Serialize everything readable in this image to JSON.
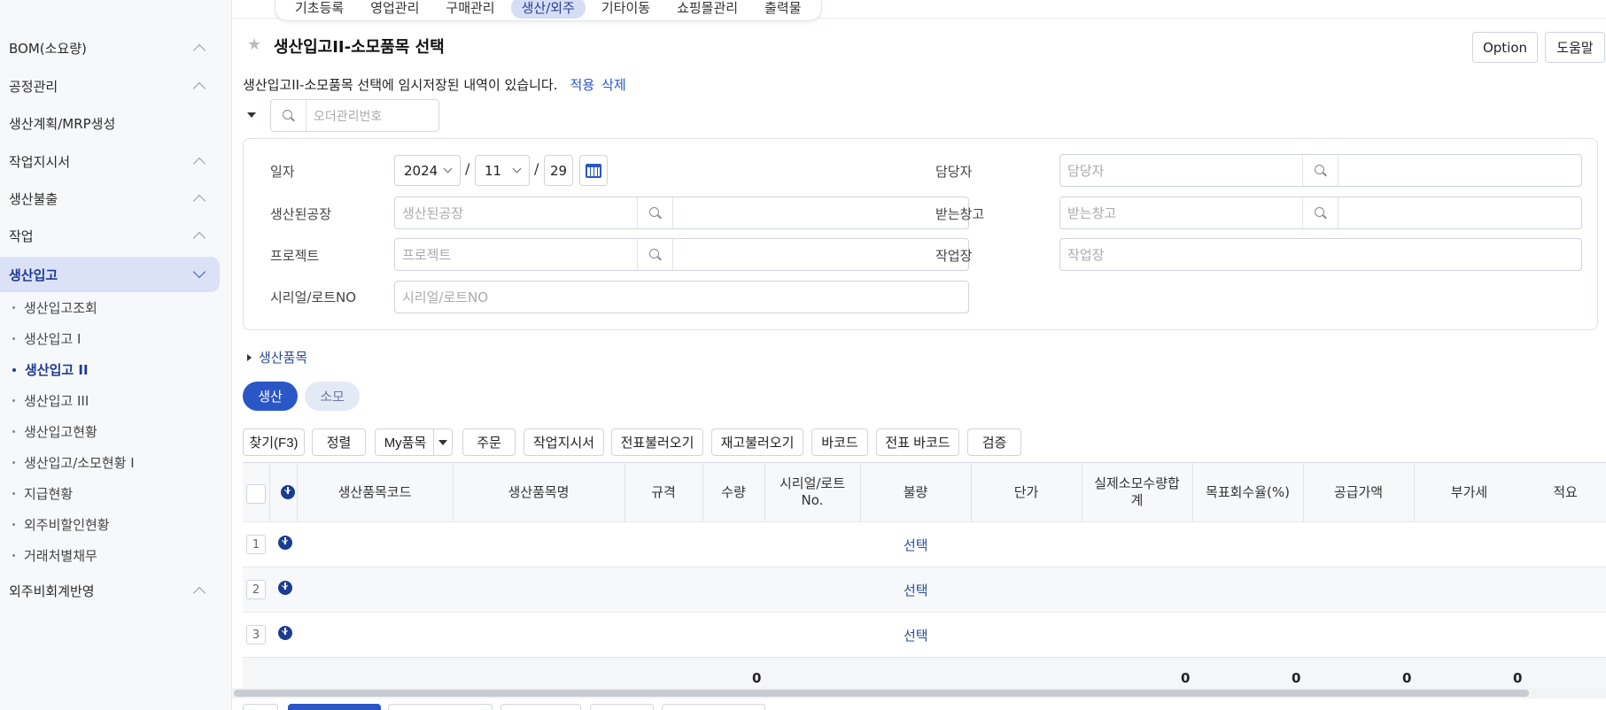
{
  "top_menu": [
    "기초등록",
    "영업관리",
    "구매관리",
    "생산/외주",
    "기타이동",
    "쇼핑몰관리",
    "출력물"
  ],
  "sidebar": {
    "groups": {
      "bom": "BOM(소요량)",
      "process": "공정관리",
      "plan": "생산계획/MRP생성",
      "workorder": "작업지시서",
      "issue": "생산불출",
      "work": "작업",
      "receipt": "생산입고",
      "outsourcing": "외주비회계반영"
    },
    "sub_items": [
      "생산입고조회",
      "생산입고 I",
      "생산입고 II",
      "생산입고 III",
      "생산입고현황",
      "생산입고/소모현황 I",
      "지급현황",
      "외주비할인현황",
      "거래처별채무"
    ]
  },
  "header": {
    "title": "생산입고II-소모품목 선택",
    "option_label": "Option",
    "help_label": "도움말",
    "notice": "생산입고II-소모품목 선택에 임시저장된 내역이 있습니다.",
    "apply_label": "적용",
    "delete_label": "삭제"
  },
  "order_search": {
    "placeholder": "오더관리번호"
  },
  "form": {
    "date_label": "일자",
    "year": "2024",
    "month": "11",
    "day": "29",
    "date_sep": "/",
    "factory_label": "생산된공장",
    "factory_placeholder": "생산된공장",
    "project_label": "프로젝트",
    "project_placeholder": "프로젝트",
    "serial_label": "시리얼/로트NO",
    "serial_placeholder": "시리얼/로트NO",
    "manager_label": "담당자",
    "manager_placeholder": "담당자",
    "warehouse_label": "받는창고",
    "warehouse_placeholder": "받는창고",
    "workplace_label": "작업장",
    "workplace_placeholder": "작업장"
  },
  "section_toggle": "생산품목",
  "tabs": {
    "production": "생산",
    "consumption": "소모"
  },
  "toolbar": {
    "find": "찾기(F3)",
    "sort": "정렬",
    "my_items": "My품목",
    "order": "주문",
    "workorder": "작업지시서",
    "load_slip": "전표불러오기",
    "load_stock": "재고불러오기",
    "barcode": "바코드",
    "slip_barcode": "전표 바코드",
    "verify": "검증"
  },
  "grid": {
    "headers": {
      "code": "생산품목코드",
      "name": "생산품목명",
      "spec": "규격",
      "qty": "수량",
      "serial": "시리얼/로트\nNo.",
      "defect": "불량",
      "price": "단가",
      "actual": "실제소모수량합\n계",
      "target": "목표회수율(%)",
      "supply": "공급가액",
      "vat": "부가세",
      "note": "적요"
    },
    "rows": [
      {
        "num": "1",
        "defect": "선택"
      },
      {
        "num": "2",
        "defect": "선택"
      },
      {
        "num": "3",
        "defect": "선택"
      }
    ],
    "footer": {
      "qty": "0",
      "actual": "0",
      "target": "0",
      "supply": "0",
      "vat": "0"
    }
  }
}
